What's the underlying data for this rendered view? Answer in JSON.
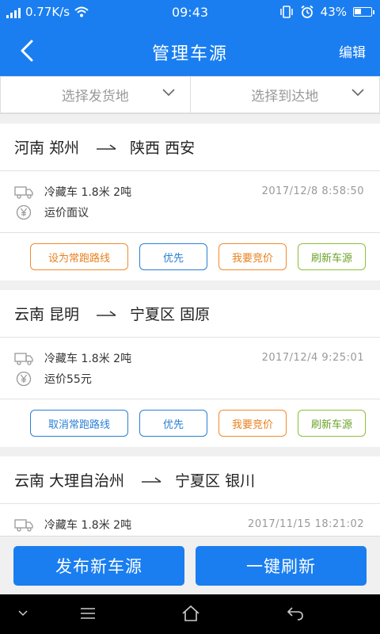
{
  "status": {
    "net_speed": "0.77K/s",
    "time": "09:43",
    "battery": "43%",
    "battery_level": 0.43
  },
  "nav": {
    "title": "管理车源",
    "edit_label": "编辑"
  },
  "filters": {
    "origin_placeholder": "选择发货地",
    "dest_placeholder": "选择到达地"
  },
  "listings": [
    {
      "origin": "河南 郑州",
      "dest": "陕西 西安",
      "vehicle": "冷藏车  1.8米  2吨",
      "price": "运价面议",
      "time": "2017/12/8   8:58:50",
      "btn1": "设为常跑路线",
      "btn2": "优先",
      "btn3": "我要竞价",
      "btn4": "刷新车源"
    },
    {
      "origin": "云南 昆明",
      "dest": "宁夏区 固原",
      "vehicle": "冷藏车  1.8米  2吨",
      "price": "运价55元",
      "time": "2017/12/4   9:25:01",
      "btn1": "取消常跑路线",
      "btn2": "优先",
      "btn3": "我要竞价",
      "btn4": "刷新车源"
    },
    {
      "origin": "云南 大理自治州",
      "dest": "宁夏区 银川",
      "vehicle": "冷藏车  1.8米  2吨",
      "price": "",
      "time": "2017/11/15   18:21:02"
    }
  ],
  "bottom": {
    "publish_label": "发布新车源",
    "refresh_all_label": "一键刷新"
  },
  "colors": {
    "primary": "#1a7ef0",
    "orange": "#f08a2c",
    "blue": "#2a7fd4",
    "green": "#8bbf3a"
  }
}
